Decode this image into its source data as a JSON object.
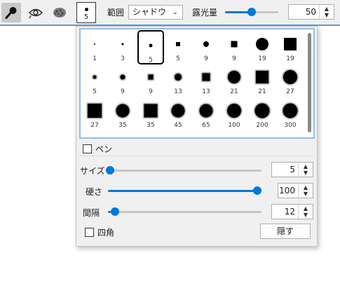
{
  "toolbar": {
    "tools": [
      {
        "name": "brush-tool",
        "selected": true
      },
      {
        "name": "dodge-tool",
        "selected": false
      },
      {
        "name": "sponge-tool",
        "selected": false
      }
    ],
    "preset_size": "5",
    "range_label": "範囲",
    "range_value": "シャドウ",
    "exposure_label": "露光量",
    "exposure_value": "50",
    "exposure_fraction": 0.5
  },
  "popup": {
    "brushes": [
      {
        "label": "1",
        "shape": "round"
      },
      {
        "label": "3",
        "shape": "round"
      },
      {
        "label": "5",
        "shape": "round",
        "selected": true
      },
      {
        "label": "5",
        "shape": "square"
      },
      {
        "label": "9",
        "shape": "round"
      },
      {
        "label": "9",
        "shape": "square"
      },
      {
        "label": "19",
        "shape": "round"
      },
      {
        "label": "19",
        "shape": "square"
      },
      {
        "label": "5",
        "shape": "round",
        "soft": true
      },
      {
        "label": "9",
        "shape": "round",
        "soft": true
      },
      {
        "label": "9",
        "shape": "square",
        "soft": true
      },
      {
        "label": "13",
        "shape": "round",
        "soft": true
      },
      {
        "label": "13",
        "shape": "square",
        "soft": true
      },
      {
        "label": "21",
        "shape": "round",
        "soft": true
      },
      {
        "label": "21",
        "shape": "square",
        "soft": true
      },
      {
        "label": "27",
        "shape": "round",
        "soft": true
      },
      {
        "label": "27",
        "shape": "square",
        "soft": true
      },
      {
        "label": "35",
        "shape": "round",
        "soft": true
      },
      {
        "label": "35",
        "shape": "square",
        "soft": true
      },
      {
        "label": "45",
        "shape": "round",
        "soft": true
      },
      {
        "label": "65",
        "shape": "round",
        "soft": true
      },
      {
        "label": "100",
        "shape": "round",
        "soft": true
      },
      {
        "label": "200",
        "shape": "round",
        "soft": true
      },
      {
        "label": "300",
        "shape": "round",
        "soft": true
      }
    ],
    "pen_label": "ペン",
    "pen_checked": false,
    "size_label": "サイズ",
    "size_value": "5",
    "size_fraction": 0.0,
    "hardness_label": "硬さ",
    "hardness_value": "100",
    "hardness_fraction": 1.0,
    "spacing_label": "間隔",
    "spacing_value": "12",
    "spacing_fraction": 0.02,
    "square_label": "四角",
    "square_checked": false,
    "hide_label": "隠す"
  }
}
